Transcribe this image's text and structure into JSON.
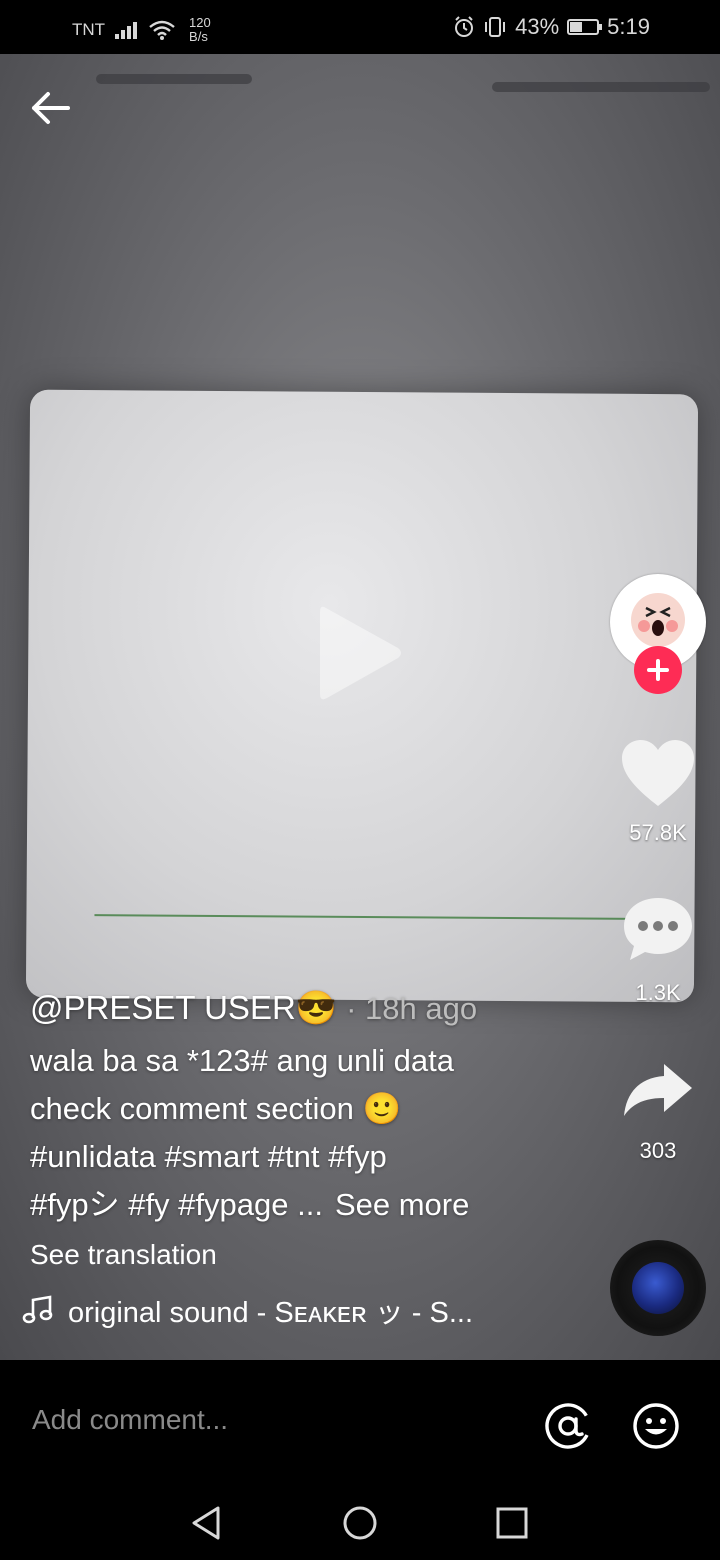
{
  "status_bar": {
    "carrier": "TNT",
    "net_speed_value": "120",
    "net_speed_unit": "B/s",
    "battery": "43%",
    "battery_level": 0.43,
    "time": "5:19"
  },
  "video": {
    "author": "@PRESET USER😎",
    "time_ago": "· 18h ago",
    "caption_lines": [
      "wala ba sa *123# ang unli data",
      "check comment section 🙂",
      "#unlidata #smart #tnt #fyp",
      "#fypシ #fy #fypage ..."
    ],
    "see_more": "See more",
    "see_translation": "See translation",
    "sound": "original sound - Sᴇᴀᴋᴇʀ ッ - S..."
  },
  "actions": {
    "likes": "57.8K",
    "comments": "1.3K",
    "shares": "303"
  },
  "comment_bar": {
    "placeholder": "Add comment..."
  },
  "colors": {
    "follow_accent": "#fe2c55"
  }
}
